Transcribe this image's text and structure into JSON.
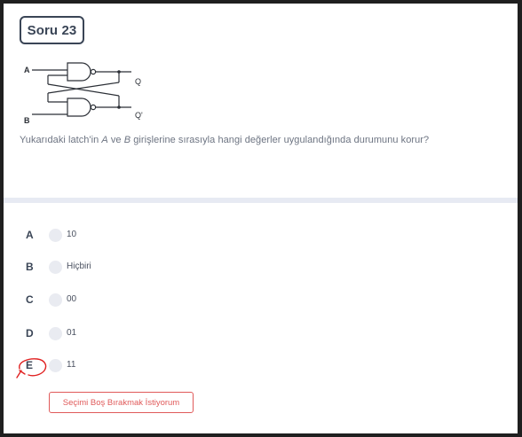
{
  "question": {
    "badge": "Soru 23",
    "text_before_a": "Yukarıdaki latch'in ",
    "var_a": "A",
    "text_middle": " ve ",
    "var_b": "B",
    "text_after": " girişlerine sırasıyla hangi değerler uygulandığında durumunu korur?"
  },
  "diagram": {
    "input_a": "A",
    "input_b": "B",
    "output_q": "Q",
    "output_q_prime": "Q'"
  },
  "options": [
    {
      "letter": "A",
      "text": "10"
    },
    {
      "letter": "B",
      "text": "Hiçbiri"
    },
    {
      "letter": "C",
      "text": "00"
    },
    {
      "letter": "D",
      "text": "01"
    },
    {
      "letter": "E",
      "text": "11"
    }
  ],
  "skip_button": "Seçimi Boş Bırakmak İstiyorum",
  "colors": {
    "badge_border": "#3a4556",
    "divider": "#e7eaf3",
    "skip_accent": "#e05a5a",
    "annotation": "#e02020"
  }
}
